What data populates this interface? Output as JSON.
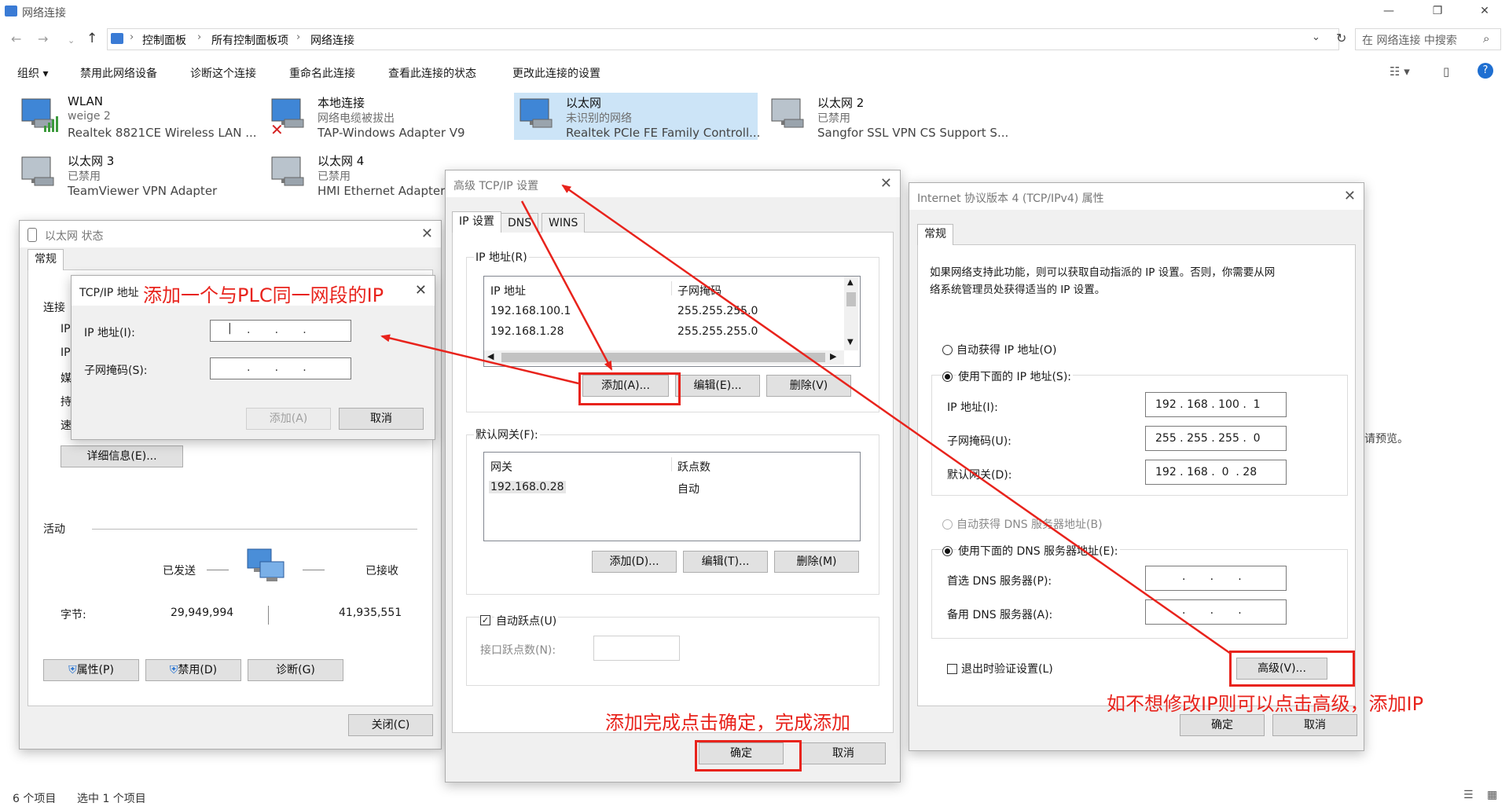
{
  "window": {
    "title": "网络连接",
    "min": "—",
    "max": "❐",
    "close": "✕"
  },
  "address": {
    "crumbs": [
      "控制面板",
      "所有控制面板项",
      "网络连接"
    ],
    "search_placeholder": "在 网络连接 中搜索"
  },
  "toolbar": {
    "items": [
      "组织 ▾",
      "禁用此网络设备",
      "诊断这个连接",
      "重命名此连接",
      "查看此连接的状态",
      "更改此连接的设置"
    ]
  },
  "adapters": [
    {
      "name": "WLAN",
      "status": "weige 2",
      "device": "Realtek 8821CE Wireless LAN ..."
    },
    {
      "name": "本地连接",
      "status": "网络电缆被拔出",
      "device": "TAP-Windows Adapter V9"
    },
    {
      "name": "以太网",
      "status": "未识别的网络",
      "device": "Realtek PCIe FE Family Controll..."
    },
    {
      "name": "以太网 2",
      "status": "已禁用",
      "device": "Sangfor SSL VPN CS Support S..."
    },
    {
      "name": "以太网 3",
      "status": "已禁用",
      "device": "TeamViewer VPN Adapter"
    },
    {
      "name": "以太网 4",
      "status": "已禁用",
      "device": "HMI Ethernet Adapter"
    }
  ],
  "preview_text": "请预览。",
  "statusbar": {
    "count": "6 个项目",
    "selected": "选中 1 个项目"
  },
  "status_dialog": {
    "title": "以太网 状态",
    "tab": "常规",
    "section_conn": "连接",
    "labels_cut": [
      "IP",
      "IP",
      "媒",
      "持",
      "速"
    ],
    "details_btn": "详细信息(E)...",
    "section_activity": "活动",
    "sent": "已发送",
    "received": "已接收",
    "bytes_label": "字节:",
    "bytes_sent": "29,949,994",
    "bytes_recv": "41,935,551",
    "btn_props": "属性(P)",
    "btn_disable": "禁用(D)",
    "btn_diag": "诊断(G)",
    "btn_close": "关闭(C)"
  },
  "tcpip_add": {
    "title": "TCP/IP 地址",
    "ip_label": "IP 地址(I):",
    "mask_label": "子网掩码(S):",
    "dots": ".       .       .",
    "btn_add": "添加(A)",
    "btn_cancel": "取消"
  },
  "advanced": {
    "title": "高级 TCP/IP 设置",
    "tabs": [
      "IP 设置",
      "DNS",
      "WINS"
    ],
    "ip_group": "IP 地址(R)",
    "col_ip": "IP 地址",
    "col_mask": "子网掩码",
    "ip_rows": [
      {
        "ip": "192.168.100.1",
        "mask": "255.255.255.0"
      },
      {
        "ip": "192.168.1.28",
        "mask": "255.255.255.0"
      }
    ],
    "btn_add": "添加(A)...",
    "btn_edit": "编辑(E)...",
    "btn_del": "删除(V)",
    "gw_group": "默认网关(F):",
    "col_gw": "网关",
    "col_metric": "跃点数",
    "gw_rows": [
      {
        "gw": "192.168.0.28",
        "metric": "自动"
      }
    ],
    "btn_add2": "添加(D)...",
    "btn_edit2": "编辑(T)...",
    "btn_del2": "删除(M)",
    "auto_metric": "自动跃点(U)",
    "iface_metric": "接口跃点数(N):",
    "btn_ok": "确定",
    "btn_cancel": "取消"
  },
  "ipv4": {
    "title": "Internet 协议版本 4 (TCP/IPv4) 属性",
    "tab": "常规",
    "desc1": "如果网络支持此功能，则可以获取自动指派的 IP 设置。否则，你需要从网",
    "desc2": "络系统管理员处获得适当的 IP 设置。",
    "auto_ip": "自动获得 IP 地址(O)",
    "manual_ip": "使用下面的 IP 地址(S):",
    "ip_label": "IP 地址(I):",
    "ip_value": "192 . 168 . 100 .  1",
    "mask_label": "子网掩码(U):",
    "mask_value": "255 . 255 . 255 .  0",
    "gw_label": "默认网关(D):",
    "gw_value": "192 . 168 .  0  . 28",
    "auto_dns": "自动获得 DNS 服务器地址(B)",
    "manual_dns": "使用下面的 DNS 服务器地址(E):",
    "dns1_label": "首选 DNS 服务器(P):",
    "dns2_label": "备用 DNS 服务器(A):",
    "dns_dots": ".       .       .",
    "validate": "退出时验证设置(L)",
    "btn_advanced": "高级(V)...",
    "btn_ok": "确定",
    "btn_cancel": "取消"
  },
  "annotations": {
    "add_ip": "添加一个与PLC同一网段的IP",
    "confirm": "添加完成点击确定，完成添加",
    "advanced_hint": "如不想修改IP则可以点击高级，添加IP"
  },
  "colors": {
    "annotation": "#e8231c",
    "selected": "#cce4f7"
  }
}
